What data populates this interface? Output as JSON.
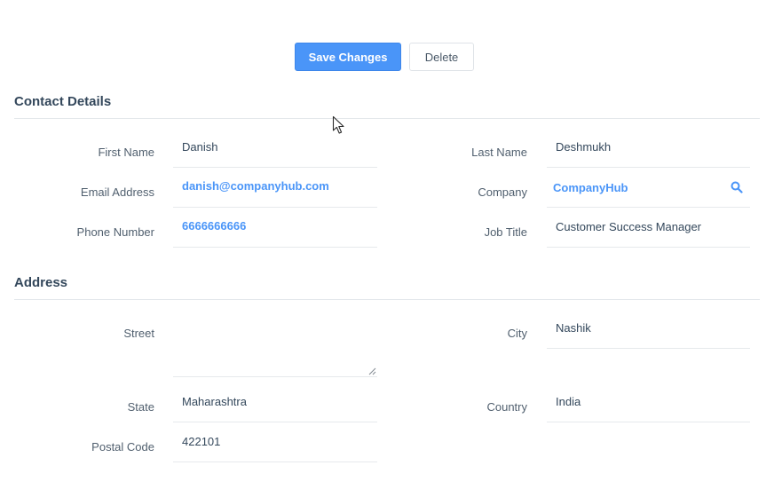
{
  "toolbar": {
    "save_label": "Save Changes",
    "delete_label": "Delete"
  },
  "contact": {
    "title": "Contact Details",
    "first_name": {
      "label": "First Name",
      "value": "Danish"
    },
    "last_name": {
      "label": "Last Name",
      "value": "Deshmukh"
    },
    "email": {
      "label": "Email Address",
      "value": "danish@companyhub.com"
    },
    "company": {
      "label": "Company",
      "value": "CompanyHub",
      "icon": "search-icon"
    },
    "phone": {
      "label": "Phone Number",
      "value": "6666666666"
    },
    "job_title": {
      "label": "Job Title",
      "value": "Customer Success Manager"
    }
  },
  "address": {
    "title": "Address",
    "street": {
      "label": "Street",
      "value": ""
    },
    "city": {
      "label": "City",
      "value": "Nashik"
    },
    "state": {
      "label": "State",
      "value": "Maharashtra"
    },
    "country": {
      "label": "Country",
      "value": "India"
    },
    "postal_code": {
      "label": "Postal Code",
      "value": "422101"
    }
  },
  "colors": {
    "accent": "#4a95f8",
    "text": "#33475b",
    "label": "#505f6e",
    "border": "#e6e9ec"
  }
}
